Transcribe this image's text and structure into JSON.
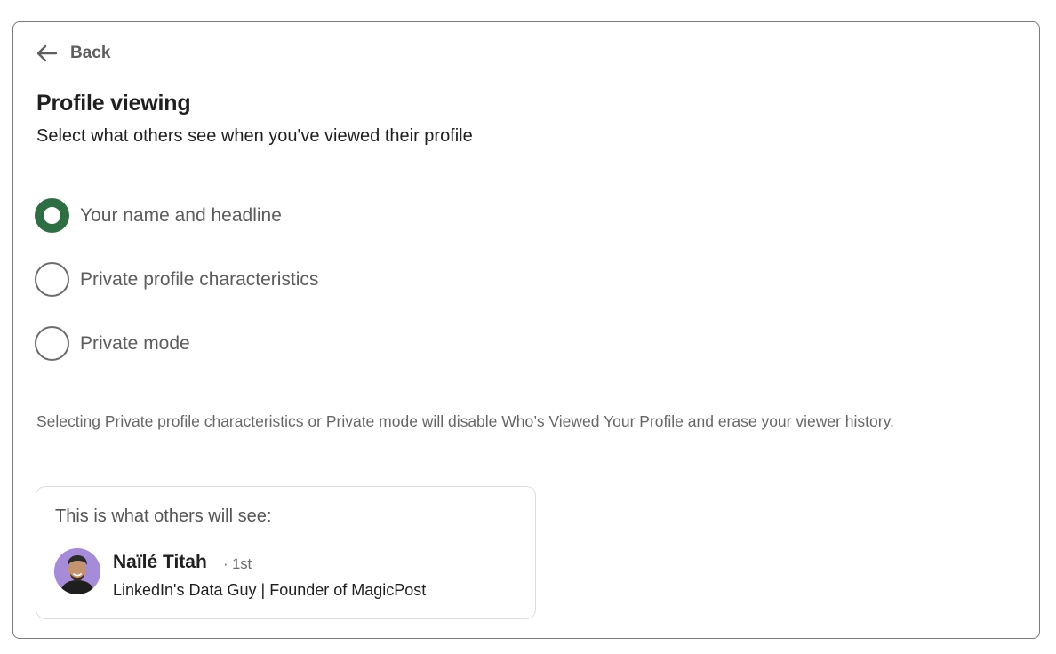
{
  "nav": {
    "back_label": "Back",
    "back_icon": "arrow-left-icon"
  },
  "page": {
    "title": "Profile viewing",
    "subtitle": "Select what others see when you've viewed their profile"
  },
  "options": [
    {
      "label": "Your name and headline",
      "selected": true
    },
    {
      "label": "Private profile characteristics",
      "selected": false
    },
    {
      "label": "Private mode",
      "selected": false
    }
  ],
  "notice": "Selecting Private profile characteristics or Private mode will disable Who’s Viewed Your Profile and erase your viewer history.",
  "preview": {
    "heading": "This is what others will see:",
    "name": "Naïlé Titah",
    "degree": "· 1st",
    "headline": "LinkedIn's Data Guy | Founder of MagicPost"
  },
  "colors": {
    "radio_selected": "#2f6d43",
    "avatar_bg": "#a58bd8"
  }
}
